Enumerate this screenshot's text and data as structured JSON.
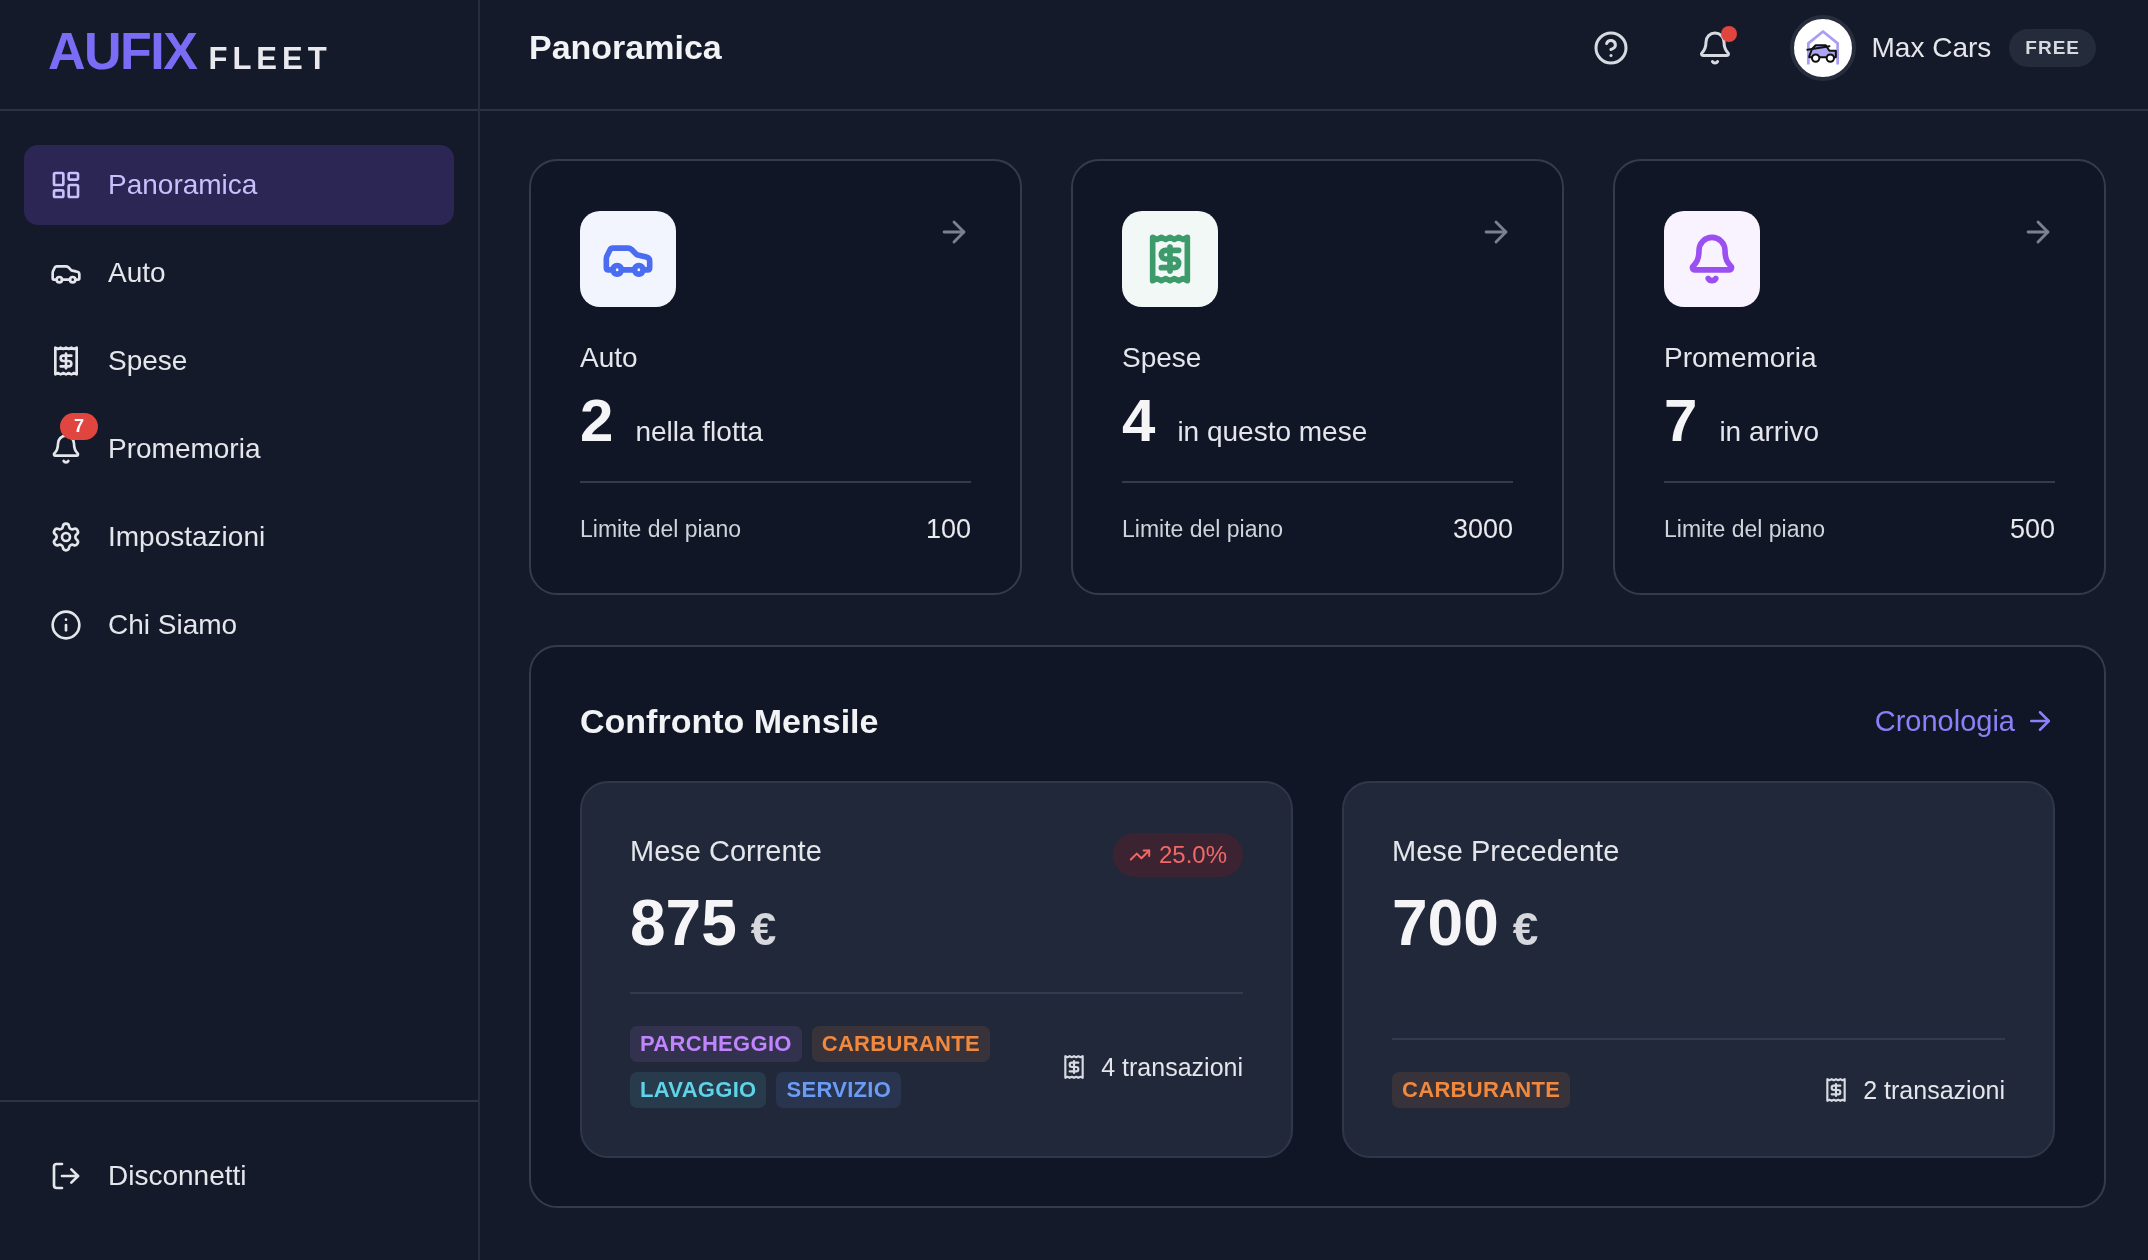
{
  "brand": {
    "name": "AUFIX",
    "product": "FLEET"
  },
  "sidebar": {
    "items": [
      {
        "label": "Panoramica",
        "selected": true
      },
      {
        "label": "Auto",
        "selected": false
      },
      {
        "label": "Spese",
        "selected": false
      },
      {
        "label": "Promemoria",
        "selected": false,
        "badge": "7"
      },
      {
        "label": "Impostazioni",
        "selected": false
      },
      {
        "label": "Chi Siamo",
        "selected": false
      }
    ],
    "logout": {
      "label": "Disconnetti"
    }
  },
  "header": {
    "title": "Panoramica",
    "notifications": {
      "unread": true
    },
    "user": {
      "name": "Max Cars",
      "plan": "FREE"
    }
  },
  "stat_cards": [
    {
      "label": "Auto",
      "count": "2",
      "caption": "nella flotta",
      "limit_label": "Limite del piano",
      "limit": "100",
      "color": "#4a6cf0"
    },
    {
      "label": "Spese",
      "count": "4",
      "caption": "in questo mese",
      "limit_label": "Limite del piano",
      "limit": "3000",
      "color": "#3d9a6b"
    },
    {
      "label": "Promemoria",
      "count": "7",
      "caption": "in arrivo",
      "limit_label": "Limite del piano",
      "limit": "500",
      "color": "#9b4ff0"
    }
  ],
  "comparison": {
    "title": "Confronto Mensile",
    "link": "Cronologia",
    "months": [
      {
        "label": "Mese Corrente",
        "amount": "875",
        "currency": "€",
        "change": {
          "value": "25.0%"
        },
        "tags": [
          {
            "label": "PARCHEGGIO",
            "color": "#c084fc"
          },
          {
            "label": "CARBURANTE",
            "color": "#f0883e"
          },
          {
            "label": "LAVAGGIO",
            "color": "#5fd3e8"
          },
          {
            "label": "SERVIZIO",
            "color": "#6b9bf5"
          }
        ],
        "transactions": "4 transazioni"
      },
      {
        "label": "Mese Precedente",
        "amount": "700",
        "currency": "€",
        "tags": [
          {
            "label": "CARBURANTE",
            "color": "#f0883e"
          }
        ],
        "transactions": "2 transazioni"
      }
    ]
  }
}
